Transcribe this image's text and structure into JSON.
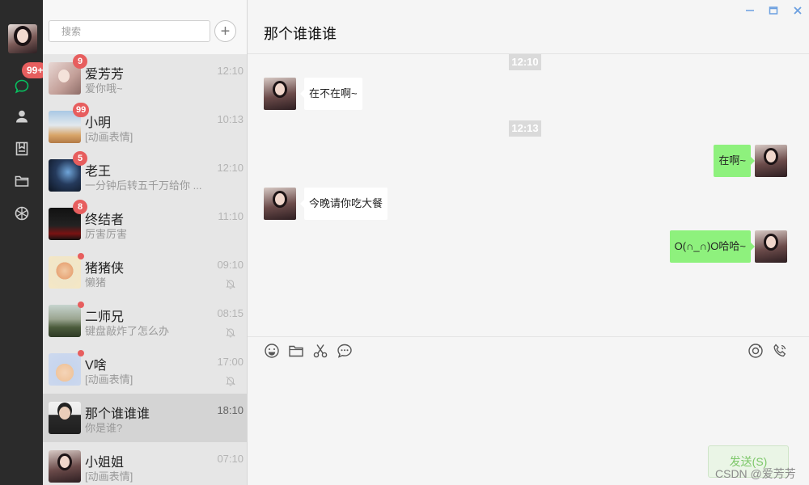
{
  "rail": {
    "unread_badge": "99+",
    "nav_icons": [
      "chat-icon",
      "contacts-icon",
      "favorites-icon",
      "folder-icon",
      "moments-icon"
    ],
    "active_color": "#07c160"
  },
  "search": {
    "placeholder": "搜索",
    "add_label": "+"
  },
  "conversations": [
    {
      "name": "爱芳芳",
      "preview": "爱你哦~",
      "time": "12:10",
      "badge": "9"
    },
    {
      "name": "小明",
      "preview": "[动画表情]",
      "time": "10:13",
      "badge": "99"
    },
    {
      "name": "老王",
      "preview": "一分钟后转五千万给你 ...",
      "time": "12:10",
      "badge": "5"
    },
    {
      "name": "终结者",
      "preview": "厉害厉害",
      "time": "11:10",
      "badge": "8"
    },
    {
      "name": "猪猪侠",
      "preview": "懒猪",
      "time": "09:10",
      "muted": true
    },
    {
      "name": "二师兄",
      "preview": "键盘敲炸了怎么办",
      "time": "08:15",
      "muted": true
    },
    {
      "name": "V啥",
      "preview": "[动画表情]",
      "time": "17:00",
      "muted": true
    },
    {
      "name": "那个谁谁谁",
      "preview": "你是谁?",
      "time": "18:10",
      "active": true
    },
    {
      "name": "小姐姐",
      "preview": "[动画表情]",
      "time": "07:10"
    }
  ],
  "chat": {
    "title": "那个谁谁谁",
    "stamps": [
      "12:10",
      "12:13"
    ],
    "messages": [
      {
        "dir": "in",
        "text": "在不在啊~"
      },
      {
        "dir": "out",
        "text": "在啊~"
      },
      {
        "dir": "in",
        "text": "今晚请你吃大餐"
      },
      {
        "dir": "out",
        "text": "O(∩_∩)O哈哈~"
      }
    ],
    "toolbar": [
      "emoji-icon",
      "folder-icon",
      "scissors-icon",
      "chat-history-icon",
      "video-call-icon",
      "voice-call-icon"
    ],
    "send_label": "发送(S)"
  },
  "watermark": "CSDN @爱芳芳",
  "colors": {
    "badge": "#e75e5e",
    "bubble_out": "#8ef17d",
    "bubble_in": "#ffffff",
    "window_controls": "#6a9fe0"
  }
}
